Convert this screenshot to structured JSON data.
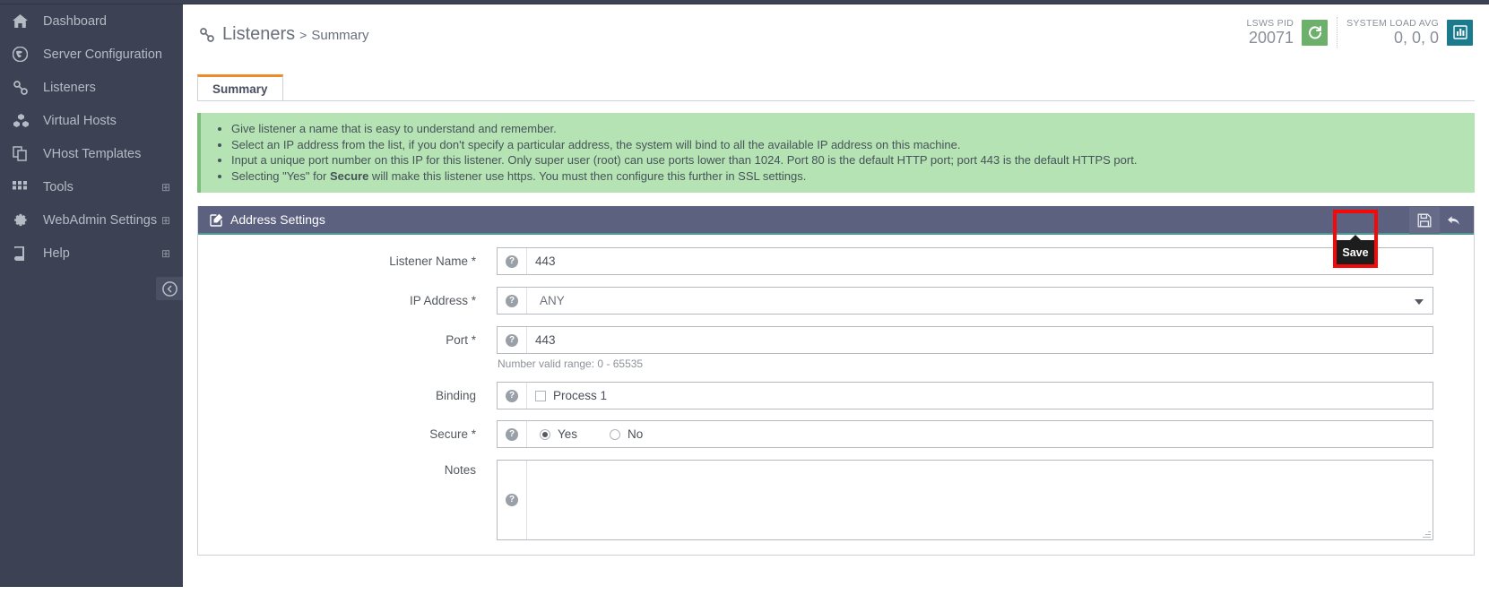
{
  "sidebar": {
    "items": [
      {
        "label": "Dashboard",
        "icon": "home-icon",
        "expandable": false
      },
      {
        "label": "Server Configuration",
        "icon": "globe-icon",
        "expandable": false
      },
      {
        "label": "Listeners",
        "icon": "link-icon",
        "expandable": false
      },
      {
        "label": "Virtual Hosts",
        "icon": "cubes-icon",
        "expandable": false
      },
      {
        "label": "VHost Templates",
        "icon": "copy-icon",
        "expandable": false
      },
      {
        "label": "Tools",
        "icon": "grid-icon",
        "expandable": true
      },
      {
        "label": "WebAdmin Settings",
        "icon": "gear-icon",
        "expandable": true
      },
      {
        "label": "Help",
        "icon": "book-icon",
        "expandable": true
      }
    ],
    "expand_glyph": "⊞",
    "collapse_button": "collapse-sidebar-button"
  },
  "header": {
    "breadcrumb": {
      "icon": "link-icon",
      "root": "Listeners",
      "separator": ">",
      "current": "Summary"
    },
    "status": {
      "pid": {
        "label": "LSWS PID",
        "value": "20071",
        "button_icon": "restart-icon",
        "button_color": "#6cb06b"
      },
      "load": {
        "label": "SYSTEM LOAD AVG",
        "value": "0, 0, 0",
        "button_icon": "chart-icon",
        "button_color": "#1b7b8c"
      }
    }
  },
  "tabs": [
    {
      "label": "Summary",
      "active": true
    }
  ],
  "info": {
    "lines": [
      "Give listener a name that is easy to understand and remember.",
      "Select an IP address from the list, if you don't specify a particular address, the system will bind to all the available IP address on this machine.",
      "Input a unique port number on this IP for this listener. Only super user (root) can use ports lower than 1024. Port 80 is the default HTTP port; port 443 is the default HTTPS port."
    ],
    "line4_pre": "Selecting \"Yes\" for ",
    "line4_bold": "Secure",
    "line4_post": " will make this listener use https. You must then configure this further in SSL settings."
  },
  "panel": {
    "title": "Address Settings",
    "title_icon": "edit-icon",
    "actions": {
      "save": {
        "name": "save-button",
        "icon": "floppy-disk-icon",
        "tooltip": "Save"
      },
      "undo": {
        "name": "undo-button",
        "icon": "undo-arrow-icon"
      }
    },
    "highlight_color": "#f40808"
  },
  "form": {
    "listener_name": {
      "label": "Listener Name *",
      "value": "443",
      "help_icon": "question-circle-icon"
    },
    "ip_address": {
      "label": "IP Address *",
      "value": "ANY",
      "help_icon": "question-circle-icon",
      "caret": "chevron-down-icon"
    },
    "port": {
      "label": "Port *",
      "value": "443",
      "help_icon": "question-circle-icon",
      "hint": "Number valid range: 0 - 65535"
    },
    "binding": {
      "label": "Binding",
      "checkbox_label": "Process 1",
      "checked": false,
      "help_icon": "question-circle-icon"
    },
    "secure": {
      "label": "Secure *",
      "yes_label": "Yes",
      "no_label": "No",
      "selected": "Yes",
      "help_icon": "question-circle-icon"
    },
    "notes": {
      "label": "Notes",
      "value": "",
      "placeholder": "",
      "help_icon": "question-circle-icon"
    }
  }
}
